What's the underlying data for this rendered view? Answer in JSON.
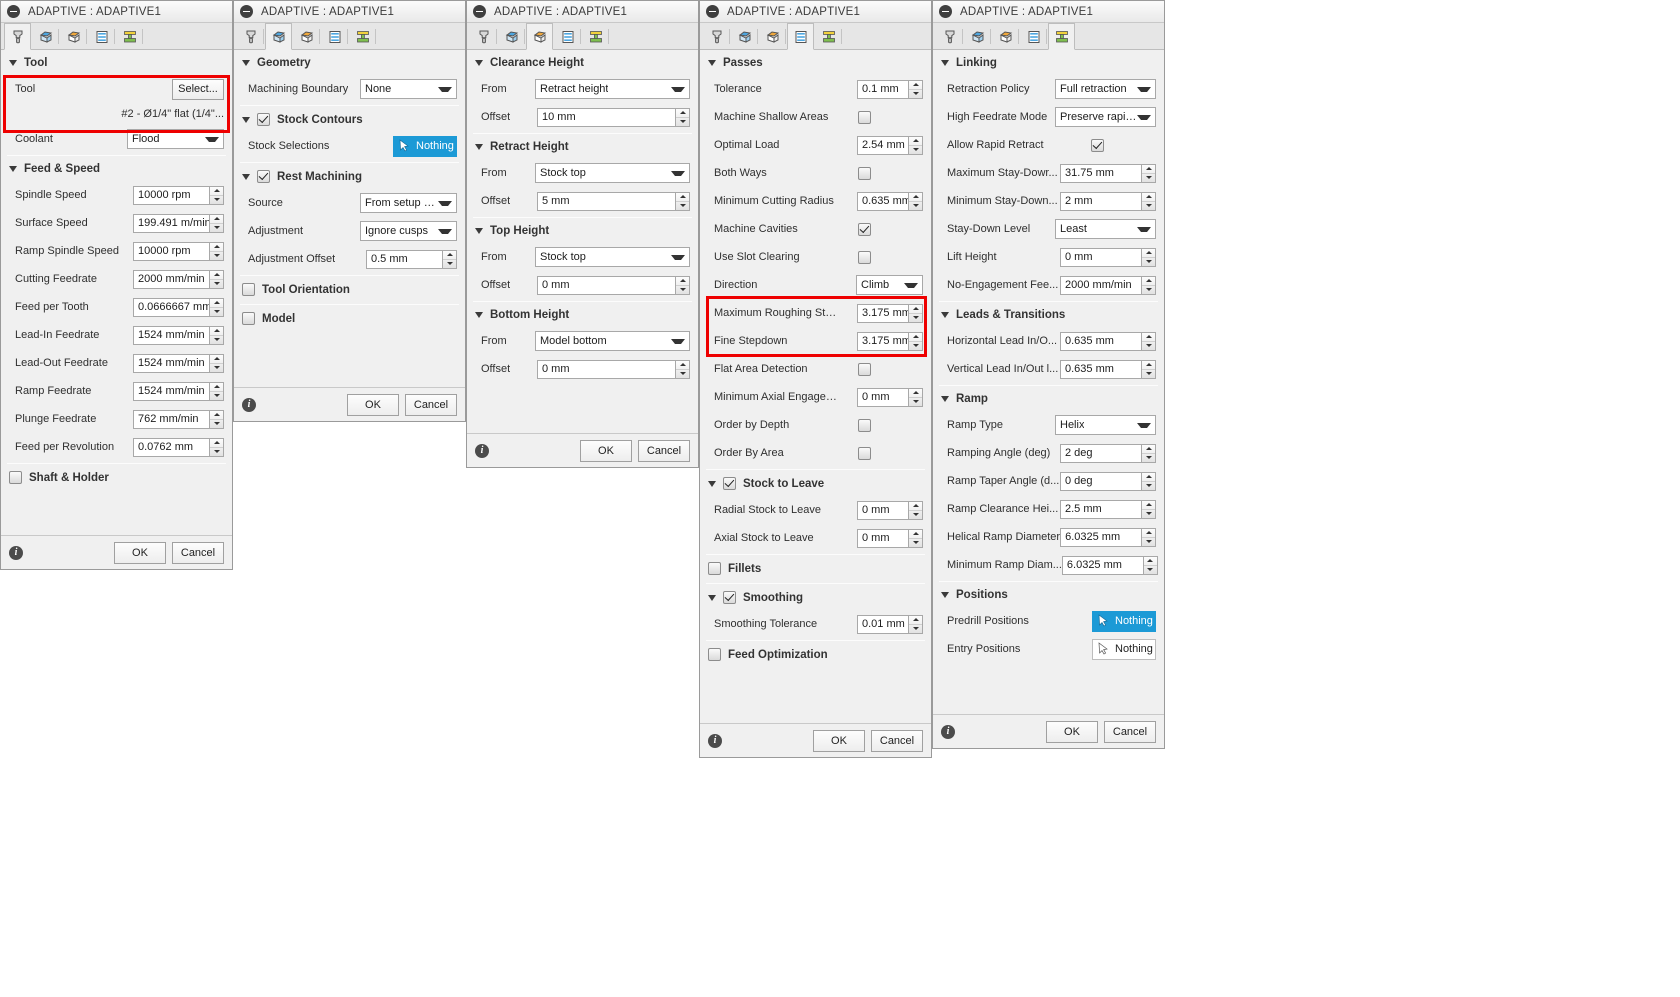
{
  "window_title": "ADAPTIVE : ADAPTIVE1",
  "tab_icons": [
    "tool-tab-icon",
    "geometry-tab-icon",
    "heights-tab-icon",
    "passes-tab-icon",
    "linking-tab-icon"
  ],
  "accent_color": "#1c9ad6",
  "annotation_color": "#ee0000",
  "common": {
    "ok": "OK",
    "cancel": "Cancel",
    "info": "i"
  },
  "panel_tool": {
    "title": "ADAPTIVE : ADAPTIVE1",
    "active_tab": 0,
    "groups": {
      "tool": {
        "label": "Tool",
        "tool_row_label": "Tool",
        "select_button": "Select...",
        "tool_description": "#2 - Ø1/4\" flat (1/4\"...",
        "coolant_label": "Coolant",
        "coolant_value": "Flood"
      },
      "feed_speed": {
        "label": "Feed & Speed",
        "rows": [
          {
            "label": "Spindle Speed",
            "value": "10000 rpm"
          },
          {
            "label": "Surface Speed",
            "value": "199.491 m/min"
          },
          {
            "label": "Ramp Spindle Speed",
            "value": "10000 rpm"
          },
          {
            "label": "Cutting Feedrate",
            "value": "2000 mm/min"
          },
          {
            "label": "Feed per Tooth",
            "value": "0.0666667 mm"
          },
          {
            "label": "Lead-In Feedrate",
            "value": "1524 mm/min"
          },
          {
            "label": "Lead-Out Feedrate",
            "value": "1524 mm/min"
          },
          {
            "label": "Ramp Feedrate",
            "value": "1524 mm/min"
          },
          {
            "label": "Plunge Feedrate",
            "value": "762 mm/min"
          },
          {
            "label": "Feed per Revolution",
            "value": "0.0762 mm"
          }
        ]
      },
      "shaft_holder": {
        "label": "Shaft & Holder",
        "checked": false
      }
    }
  },
  "panel_geometry": {
    "title": "ADAPTIVE : ADAPTIVE1",
    "active_tab": 1,
    "groups": {
      "geometry": {
        "label": "Geometry",
        "machining_boundary_label": "Machining Boundary",
        "machining_boundary_value": "None"
      },
      "stock_contours": {
        "label": "Stock Contours",
        "checked": true,
        "stock_selections_label": "Stock Selections",
        "stock_selections_value": "Nothing"
      },
      "rest_machining": {
        "label": "Rest Machining",
        "checked": true,
        "rows": [
          {
            "label": "Source",
            "value": "From setup stock",
            "type": "select"
          },
          {
            "label": "Adjustment",
            "value": "Ignore cusps",
            "type": "select"
          },
          {
            "label": "Adjustment Offset",
            "value": "0.5 mm",
            "type": "spin"
          }
        ]
      },
      "tool_orientation": {
        "label": "Tool Orientation",
        "checked": false
      },
      "model": {
        "label": "Model",
        "checked": false
      }
    }
  },
  "panel_heights": {
    "title": "ADAPTIVE : ADAPTIVE1",
    "active_tab": 2,
    "groups": [
      {
        "label": "Clearance Height",
        "from_label": "From",
        "from_value": "Retract height",
        "offset_label": "Offset",
        "offset_value": "10 mm"
      },
      {
        "label": "Retract Height",
        "from_label": "From",
        "from_value": "Stock top",
        "offset_label": "Offset",
        "offset_value": "5 mm"
      },
      {
        "label": "Top Height",
        "from_label": "From",
        "from_value": "Stock top",
        "offset_label": "Offset",
        "offset_value": "0 mm"
      },
      {
        "label": "Bottom Height",
        "from_label": "From",
        "from_value": "Model bottom",
        "offset_label": "Offset",
        "offset_value": "0 mm"
      }
    ]
  },
  "panel_passes": {
    "title": "ADAPTIVE : ADAPTIVE1",
    "active_tab": 3,
    "groups": {
      "passes": {
        "label": "Passes",
        "rows": [
          {
            "label": "Tolerance",
            "value": "0.1 mm",
            "type": "spin"
          },
          {
            "label": "Machine Shallow Areas",
            "type": "check",
            "checked": false
          },
          {
            "label": "Optimal Load",
            "value": "2.54 mm",
            "type": "spin"
          },
          {
            "label": "Both Ways",
            "type": "check",
            "checked": false
          },
          {
            "label": "Minimum Cutting Radius",
            "value": "0.635 mm",
            "type": "spin"
          },
          {
            "label": "Machine Cavities",
            "type": "check",
            "checked": true
          },
          {
            "label": "Use Slot Clearing",
            "type": "check",
            "checked": false
          },
          {
            "label": "Direction",
            "value": "Climb",
            "type": "select"
          },
          {
            "label": "Maximum Roughing Stepdov...",
            "value": "3.175 mm",
            "type": "spin"
          },
          {
            "label": "Fine Stepdown",
            "value": "3.175 mm",
            "type": "spin"
          },
          {
            "label": "Flat Area Detection",
            "type": "check",
            "checked": false
          },
          {
            "label": "Minimum Axial Engagement",
            "value": "0 mm",
            "type": "spin"
          },
          {
            "label": "Order by Depth",
            "type": "check",
            "checked": false
          },
          {
            "label": "Order By Area",
            "type": "check",
            "checked": false
          }
        ]
      },
      "stock_to_leave": {
        "label": "Stock to Leave",
        "checked": true,
        "rows": [
          {
            "label": "Radial Stock to Leave",
            "value": "0 mm"
          },
          {
            "label": "Axial Stock to Leave",
            "value": "0 mm"
          }
        ]
      },
      "fillets": {
        "label": "Fillets",
        "checked": false
      },
      "smoothing": {
        "label": "Smoothing",
        "checked": true,
        "rows": [
          {
            "label": "Smoothing Tolerance",
            "value": "0.01 mm"
          }
        ]
      },
      "feed_optimization": {
        "label": "Feed Optimization",
        "checked": false
      }
    }
  },
  "panel_linking": {
    "title": "ADAPTIVE : ADAPTIVE1",
    "active_tab": 4,
    "groups": {
      "linking": {
        "label": "Linking",
        "rows": [
          {
            "label": "Retraction Policy",
            "value": "Full retraction",
            "type": "select"
          },
          {
            "label": "High Feedrate Mode",
            "value": "Preserve rapid r...",
            "type": "select"
          },
          {
            "label": "Allow Rapid Retract",
            "type": "check",
            "checked": true
          },
          {
            "label": "Maximum Stay-Dowr...",
            "value": "31.75 mm",
            "type": "spin"
          },
          {
            "label": "Minimum Stay-Down...",
            "value": "2 mm",
            "type": "spin"
          },
          {
            "label": "Stay-Down Level",
            "value": "Least",
            "type": "select"
          },
          {
            "label": "Lift Height",
            "value": "0 mm",
            "type": "spin"
          },
          {
            "label": "No-Engagement Fee...",
            "value": "2000 mm/min",
            "type": "spin"
          }
        ]
      },
      "leads_transitions": {
        "label": "Leads & Transitions",
        "rows": [
          {
            "label": "Horizontal Lead In/O...",
            "value": "0.635 mm"
          },
          {
            "label": "Vertical Lead In/Out l...",
            "value": "0.635 mm"
          }
        ]
      },
      "ramp": {
        "label": "Ramp",
        "rows": [
          {
            "label": "Ramp Type",
            "value": "Helix",
            "type": "select"
          },
          {
            "label": "Ramping Angle (deg)",
            "value": "2 deg",
            "type": "spin"
          },
          {
            "label": "Ramp Taper Angle (d...",
            "value": "0 deg",
            "type": "spin"
          },
          {
            "label": "Ramp Clearance Hei...",
            "value": "2.5 mm",
            "type": "spin"
          },
          {
            "label": "Helical Ramp Diameter",
            "value": "6.0325 mm",
            "type": "spin"
          },
          {
            "label": "Minimum Ramp Diam...",
            "value": "6.0325 mm",
            "type": "spin"
          }
        ]
      },
      "positions": {
        "label": "Positions",
        "rows": [
          {
            "label": "Predrill Positions",
            "value": "Nothing",
            "highlight": true
          },
          {
            "label": "Entry Positions",
            "value": "Nothing",
            "highlight": false
          }
        ]
      }
    }
  }
}
